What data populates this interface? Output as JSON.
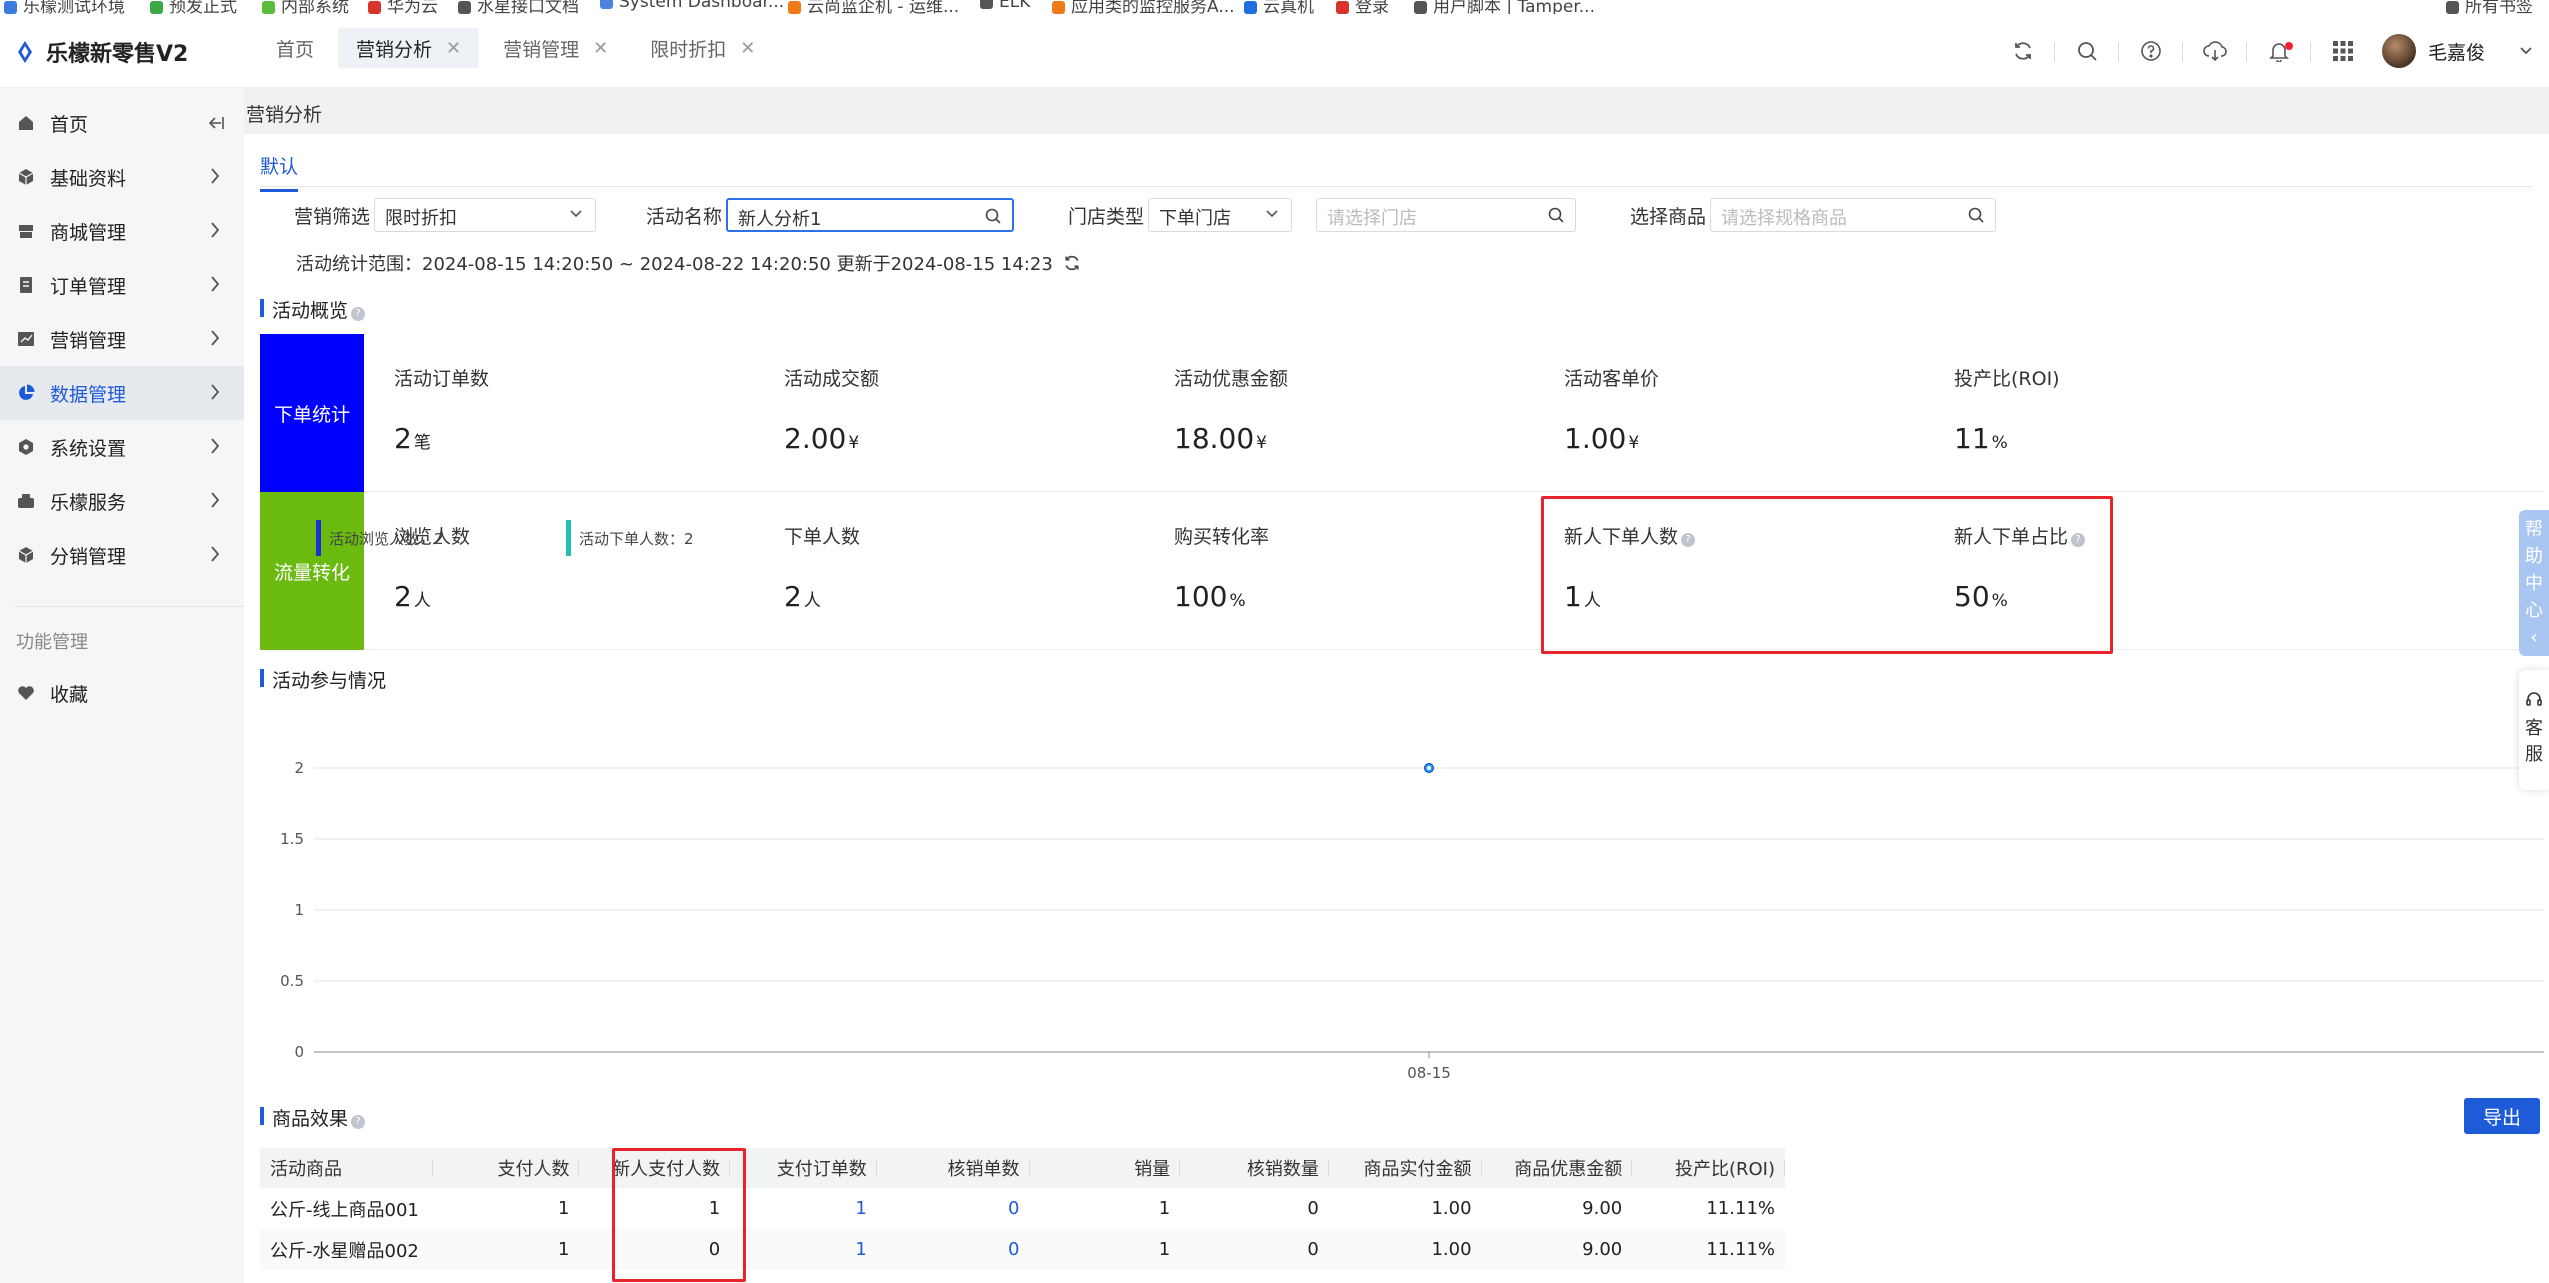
{
  "bookmarks": [
    {
      "label": "乐檬测试环境",
      "color": "#3a7be0"
    },
    {
      "label": "预发正式",
      "color": "#39a845"
    },
    {
      "label": "内部系统",
      "color": "#5bbb3a"
    },
    {
      "label": "华为云",
      "color": "#d9342b"
    },
    {
      "label": "水星接口文档",
      "color": "#555555"
    },
    {
      "label": "System Dashboar...",
      "color": "#4a84e0"
    },
    {
      "label": "云尚蓝企机 - 运维...",
      "color": "#f07a18"
    },
    {
      "label": "ELK",
      "color": "#555555"
    },
    {
      "label": "应用类的监控服务A...",
      "color": "#f07a18"
    },
    {
      "label": "云真机",
      "color": "#1e6fe0"
    },
    {
      "label": "登录",
      "color": "#d9342b"
    },
    {
      "label": "用户脚本 | Tamper...",
      "color": "#555555"
    },
    {
      "label": "所有书签",
      "color": "#555555"
    }
  ],
  "app": {
    "title": "乐檬新零售V2",
    "brand_color": "#1e5bd8"
  },
  "tabs": [
    {
      "label": "首页",
      "closable": false,
      "active": false
    },
    {
      "label": "营销分析",
      "closable": true,
      "active": true
    },
    {
      "label": "营销管理",
      "closable": true,
      "active": false
    },
    {
      "label": "限时折扣",
      "closable": true,
      "active": false
    }
  ],
  "toolbar_icons": [
    "refresh-icon",
    "search-icon",
    "help-icon",
    "download-cloud-icon",
    "bell-icon",
    "apps-grid-icon"
  ],
  "user": {
    "name": "毛嘉俊"
  },
  "sidebar": {
    "items": [
      {
        "label": "首页",
        "icon": "home-icon",
        "has_children": false
      },
      {
        "label": "基础资料",
        "icon": "cube-icon",
        "has_children": true
      },
      {
        "label": "商城管理",
        "icon": "store-icon",
        "has_children": true
      },
      {
        "label": "订单管理",
        "icon": "order-icon",
        "has_children": true
      },
      {
        "label": "营销管理",
        "icon": "chart-icon",
        "has_children": true
      },
      {
        "label": "数据管理",
        "icon": "pie-icon",
        "has_children": true,
        "active": true
      },
      {
        "label": "系统设置",
        "icon": "settings-icon",
        "has_children": true
      },
      {
        "label": "乐檬服务",
        "icon": "service-icon",
        "has_children": true
      },
      {
        "label": "分销管理",
        "icon": "distribution-icon",
        "has_children": true
      }
    ],
    "section_label": "功能管理",
    "favorites_label": "收藏"
  },
  "page": {
    "breadcrumb": "营销分析",
    "subtab": "默认",
    "filters": {
      "marketing_label": "营销筛选",
      "marketing_value": "限时折扣",
      "activity_label": "活动名称",
      "activity_value": "新人分析1",
      "store_type_label": "门店类型",
      "store_type_value": "下单门店",
      "store_placeholder": "请选择门店",
      "goods_label": "选择商品",
      "goods_placeholder": "请选择规格商品"
    },
    "range_text": "活动统计范围：2024-08-15 14:20:50 ~ 2024-08-22 14:20:50  更新于2024-08-15 14:23"
  },
  "overview": {
    "title": "活动概览",
    "order_side_label": "下单统计",
    "order_side_color": "#0000ff",
    "traffic_side_label": "流量转化",
    "traffic_side_color": "#6aba10",
    "order_stats": [
      {
        "label": "活动订单数",
        "value": "2",
        "unit": "笔"
      },
      {
        "label": "活动成交额",
        "value": "2.00",
        "unit": "¥"
      },
      {
        "label": "活动优惠金额",
        "value": "18.00",
        "unit": "¥"
      },
      {
        "label": "活动客单价",
        "value": "1.00",
        "unit": "¥"
      },
      {
        "label": "投产比(ROI)",
        "value": "11",
        "unit": "%"
      }
    ],
    "traffic_stats": [
      {
        "label": "浏览人数",
        "value": "2",
        "unit": "人",
        "info": false
      },
      {
        "label": "下单人数",
        "value": "2",
        "unit": "人",
        "info": false
      },
      {
        "label": "购买转化率",
        "value": "100",
        "unit": "%",
        "info": false
      },
      {
        "label": "新人下单人数",
        "value": "1",
        "unit": "人",
        "info": true
      },
      {
        "label": "新人下单占比",
        "value": "50",
        "unit": "%",
        "info": true
      }
    ]
  },
  "participation": {
    "title": "活动参与情况",
    "legend": [
      {
        "label": "活动浏览人数：2",
        "color": "#1a2fd6"
      },
      {
        "label": "活动下单人数：2",
        "color": "#20c0b0"
      }
    ]
  },
  "chart_data": {
    "type": "line",
    "x": [
      "08-15"
    ],
    "series": [
      {
        "name": "活动浏览人数",
        "values": [
          2
        ]
      },
      {
        "name": "活动下单人数",
        "values": [
          2
        ]
      }
    ],
    "ylim": [
      0,
      2
    ],
    "yticks": [
      "0",
      "0.5",
      "1",
      "1.5",
      "2"
    ],
    "grid": true,
    "legend_placement": "top-left"
  },
  "goods": {
    "title": "商品效果",
    "export_label": "导出",
    "columns": [
      "活动商品",
      "支付人数",
      "新人支付人数",
      "支付订单数",
      "核销单数",
      "销量",
      "核销数量",
      "商品实付金额",
      "商品优惠金额",
      "投产比(ROI)"
    ],
    "rows": [
      [
        "公斤-线上商品001",
        "1",
        "1",
        "1",
        "0",
        "1",
        "0",
        "1.00",
        "9.00",
        "11.11%"
      ],
      [
        "公斤-水星赠品002",
        "1",
        "0",
        "1",
        "0",
        "1",
        "0",
        "1.00",
        "9.00",
        "11.11%"
      ]
    ]
  },
  "floating": {
    "help": "帮助中心",
    "service": "客服"
  }
}
